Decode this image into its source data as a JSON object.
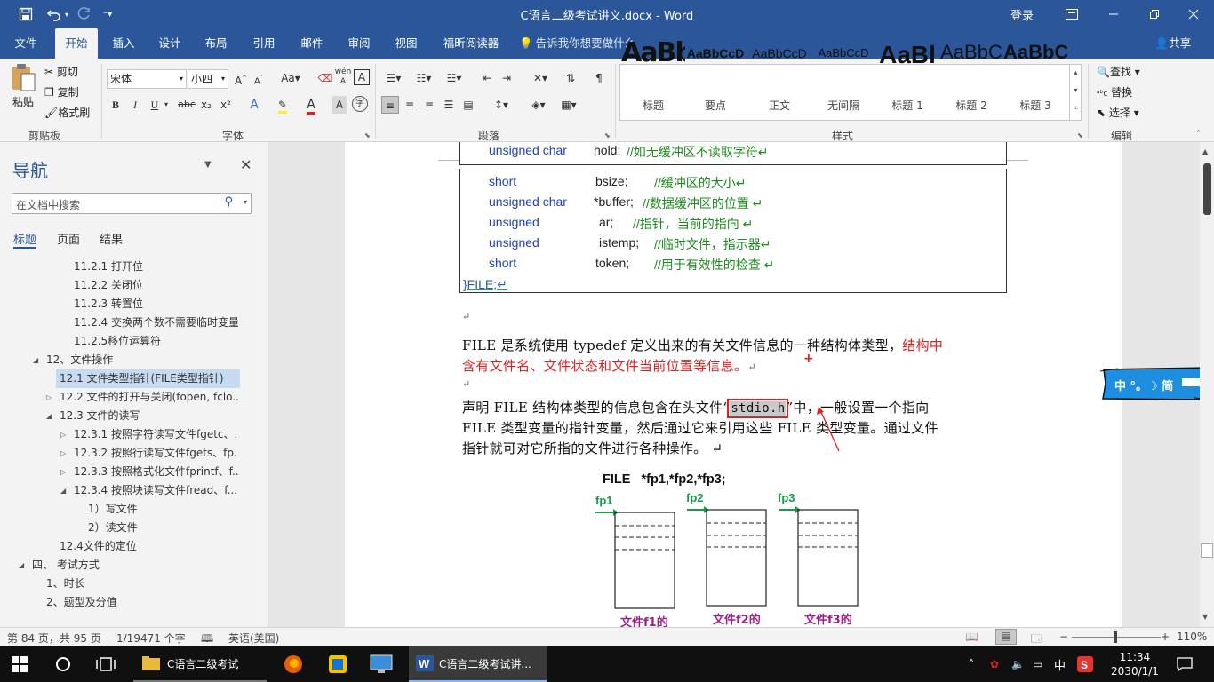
{
  "window": {
    "title": "C语言二级考试讲义.docx  -  Word",
    "login": "登录"
  },
  "tabs": [
    "文件",
    "开始",
    "插入",
    "设计",
    "布局",
    "引用",
    "邮件",
    "审阅",
    "视图",
    "福昕阅读器"
  ],
  "tell_me": "告诉我你想要做什么",
  "share": "共享",
  "ribbon": {
    "clipboard": {
      "paste": "粘贴",
      "cut": "剪切",
      "copy": "复制",
      "format_painter": "格式刷",
      "group": "剪贴板"
    },
    "font": {
      "name": "宋体",
      "size": "小四",
      "group": "字体",
      "change_case": "Aa",
      "phonetic": "wén",
      "phonetic_char": "A",
      "border_char": "A",
      "bold": "B",
      "italic": "I",
      "underline": "U",
      "strike": "abc",
      "sub": "x₂",
      "sup": "x²",
      "color_a": "A",
      "shade_a": "A",
      "enclose": "字"
    },
    "paragraph": {
      "group": "段落"
    },
    "styles": {
      "group": "样式",
      "items": [
        {
          "preview": "AaBbCcD",
          "name": "标题"
        },
        {
          "preview": "AaBbCcD",
          "name": "要点"
        },
        {
          "preview": "AaBbCcD",
          "name": "正文"
        },
        {
          "preview": "AaBbCcD",
          "name": "无间隔"
        },
        {
          "preview": "AaBl",
          "name": "标题 1"
        },
        {
          "preview": "AaBbC",
          "name": "标题 2"
        },
        {
          "preview": "AaBbC",
          "name": "标题 3"
        }
      ]
    },
    "editing": {
      "find": "查找",
      "replace": "替换",
      "select": "选择",
      "group": "编辑"
    }
  },
  "nav": {
    "title": "导航",
    "search_placeholder": "在文档中搜索",
    "tabs": [
      "标题",
      "页面",
      "结果"
    ],
    "items": [
      {
        "text": "11.2.1 打开位",
        "level": 3,
        "arrow": ""
      },
      {
        "text": "11.2.2 关闭位",
        "level": 3,
        "arrow": ""
      },
      {
        "text": "11.2.3 转置位",
        "level": 3,
        "arrow": ""
      },
      {
        "text": "11.2.4 交换两个数不需要临时变量",
        "level": 3,
        "arrow": ""
      },
      {
        "text": "11.2.5移位运算符",
        "level": 3,
        "arrow": ""
      },
      {
        "text": "12、文件操作",
        "level": 1,
        "arrow": "open"
      },
      {
        "text": "12.1 文件类型指针(FILE类型指针)",
        "level": 2,
        "arrow": "",
        "selected": true
      },
      {
        "text": "12.2 文件的打开与关闭(fopen, fclo...",
        "level": 2,
        "arrow": "closed"
      },
      {
        "text": "12.3 文件的读写",
        "level": 2,
        "arrow": "open"
      },
      {
        "text": "12.3.1 按照字符读写文件fgetc、...",
        "level": 3,
        "arrow": "closed"
      },
      {
        "text": "12.3.2 按照行读写文件fgets、fp...",
        "level": 3,
        "arrow": "closed"
      },
      {
        "text": "12.3.3 按照格式化文件fprintf、f...",
        "level": 3,
        "arrow": "closed"
      },
      {
        "text": "12.3.4 按照块读写文件fread、f...",
        "level": 3,
        "arrow": "open"
      },
      {
        "text": "1）写文件",
        "level": 4,
        "arrow": ""
      },
      {
        "text": "2）读文件",
        "level": 4,
        "arrow": ""
      },
      {
        "text": "12.4文件的定位",
        "level": 2,
        "arrow": ""
      },
      {
        "text": "四、 考试方式",
        "level": 0,
        "arrow": "open"
      },
      {
        "text": "1、时长",
        "level": 1,
        "arrow": ""
      },
      {
        "text": "2、题型及分值",
        "level": 1,
        "arrow": ""
      }
    ]
  },
  "document": {
    "code_top": {
      "type": "unsigned char",
      "name": "hold;",
      "comment": "//如无缓冲区不读取字符↵"
    },
    "code_rows": [
      {
        "type": "short",
        "name": "bsize;",
        "comment": "//缓冲区的大小↵"
      },
      {
        "type": "unsigned char",
        "name": "*buffer;",
        "comment": "//数据缓冲区的位置 ↵"
      },
      {
        "type": "unsigned",
        "name": "ar;",
        "comment": "//指针，当前的指向 ↵"
      },
      {
        "type": "unsigned",
        "name": "istemp;",
        "comment": "//临时文件，指示器↵"
      },
      {
        "type": "short",
        "name": "token;",
        "comment": "//用于有效性的检查 ↵"
      }
    ],
    "code_end": "}FILE;↵",
    "blank1": "↵",
    "p1_black": "FILE 是系统使用 typedef 定义出来的有关文件信息的一种结构体类型，",
    "p1_red1": "结构中",
    "p1_red2": "含有文件名、文件状态和文件当前位置等信息。",
    "p1_end": "↵",
    "blank2": "↵",
    "p2_l1a": "声明 FILE 结构体类型的信息包含在头文件“",
    "p2_hl": "stdio.h",
    "p2_l1b": "”中，一般设置一个指向",
    "p2_l2": "FILE 类型变量的指针变量，然后通过它来引用这些 FILE 类型变量。通过文件",
    "p2_l3": "指针就可对它所指的文件进行各种操作。 ↵",
    "figure": {
      "decl": "FILE   *fp1,*fp2,*fp3;",
      "ptrs": [
        "fp1",
        "fp2",
        "fp3"
      ],
      "files": [
        "文件f1的",
        "文件f2的",
        "文件f3的"
      ]
    }
  },
  "ime": {
    "text": "中 °。☽  简"
  },
  "status": {
    "page": "第 84 页，共 95 页",
    "words": "1/19471 个字",
    "lang": "英语(美国)",
    "zoom": "110%"
  },
  "taskbar": {
    "apps": [
      {
        "label": "C语言二级考试"
      },
      {
        "label": "C语言二级考试讲..."
      }
    ],
    "ime": "中",
    "time": "11:34",
    "date": "2030/1/1"
  }
}
